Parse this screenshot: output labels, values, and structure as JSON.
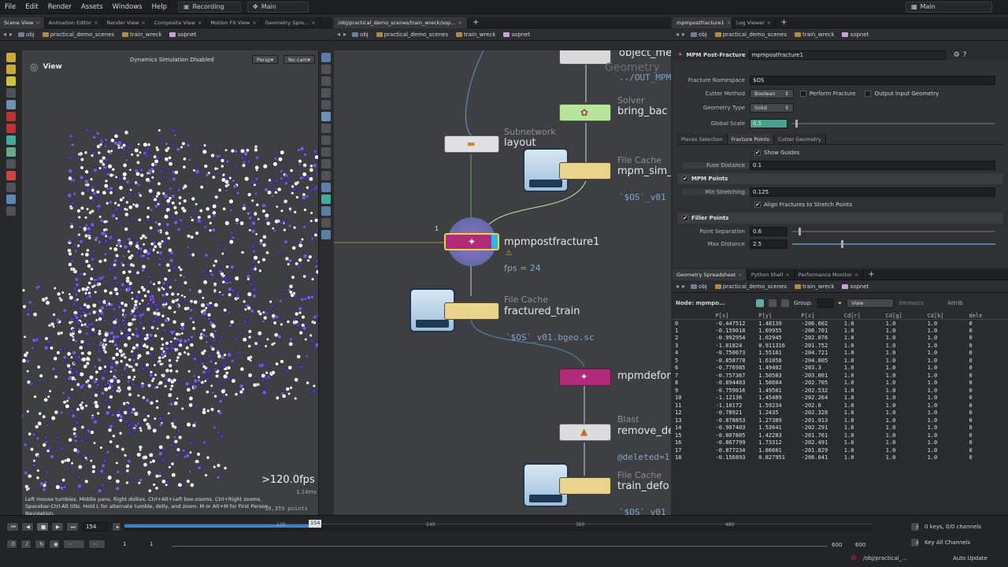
{
  "menubar": {
    "items": [
      "File",
      "Edit",
      "Render",
      "Assets",
      "Windows",
      "Help"
    ],
    "recording": "Recording",
    "desktop": "Main",
    "right_desktop": "Main"
  },
  "left_panel": {
    "tabs": [
      "Scene View",
      "Animation Editor",
      "Render View",
      "Composite View",
      "Motion FX View",
      "Geometry Spre..."
    ],
    "path": [
      "obj",
      "practical_demo_scenes",
      "train_wreck",
      "sopnet"
    ],
    "view_title": "View",
    "sim_status": "Dynamics Simulation Disabled",
    "camera": "Persp",
    "cam2": "No cam",
    "fps": ">120.0fps",
    "time_ms": "1.14ms",
    "points": "10,359  points",
    "hint": "Left mouse tumbles. Middle pans. Right dollies. Ctrl+Alt+Left box-zooms. Ctrl+Right zooms. Spacebar-Ctrl-Alt tilts. Hold L for alternate tumble, dolly, and zoom. M or Alt+M for First Person Navigation."
  },
  "network": {
    "tab": "/obj/practical_demo_scenes/train_wreck/sop...",
    "path": [
      "obj",
      "practical_demo_scenes",
      "train_wreck",
      "sopnet"
    ],
    "nodes": {
      "object_merge_label": "object_me",
      "object_merge_sub": "../OUT_MPM",
      "geometry_type": "Geometry",
      "solver_type": "Solver",
      "solver_label": "bring_bac",
      "subnet_type": "Subnetwork",
      "subnet_label": "layout",
      "filecache1_type": "File Cache",
      "filecache1_label": "mpm_sim_",
      "filecache1_sub": "`$OS`_v01",
      "post_label": "mpmpostfracture1",
      "post_fps": "fps = 24",
      "post_index": "1",
      "filecache2_type": "File Cache",
      "filecache2_label": "fractured_train",
      "filecache2_sub": "`$OS`_v01.bgeo.sc",
      "deform_label": "mpmdefor",
      "blast_type": "Blast",
      "blast_label": "remove_de",
      "blast_sub": "@deleted=1",
      "filecache3_type": "File Cache",
      "filecache3_label": "train_defo",
      "filecache3_sub": "`$OS`_v01"
    }
  },
  "params": {
    "tabs": [
      "mpmpostfracture1",
      "Log Viewer"
    ],
    "path": [
      "obj",
      "practical_demo_scenes",
      "train_wreck",
      "sopnet"
    ],
    "node_type": "MPM Post-Fracture",
    "node_name": "mpmpostfracture1",
    "namespace_label": "Fracture Namespace",
    "namespace_value": "$OS",
    "cutter_label": "Cutter Method",
    "cutter_value": "Boolean",
    "perform_fracture": "Perform Fracture",
    "output_input": "Output Input Geometry",
    "geotype_label": "Geometry Type",
    "geotype_value": "Solid",
    "scale_label": "Global Scale",
    "scale_value": "0.5",
    "subtabs": [
      "Pieces Selection",
      "Fracture Points",
      "Cutter Geometry"
    ],
    "show_guides": "Show Guides",
    "fuse_label": "Fuse Distance",
    "fuse_value": "0.1",
    "mpm_points": "MPM Points",
    "minstretch_label": "Min Stretching",
    "minstretch_value": "0.125",
    "align_label": "Align Fractures to Stretch Points",
    "filler_points": "Filler Points",
    "sep_label": "Point Separation",
    "sep_value": "0.6",
    "maxdist_label": "Max Distance",
    "maxdist_value": "2.5"
  },
  "spreadsheet": {
    "tabs": [
      "Geometry Spreadsheet",
      "Python Shell",
      "Performance Monitor"
    ],
    "path": [
      "obj",
      "practical_demo_scenes",
      "train_wreck",
      "sopnet"
    ],
    "node_label": "Node: mpmpo...",
    "group_label": "Group:",
    "view_label": "View",
    "intrinsics": "Intrinsics",
    "attrib": "Attrib",
    "columns": [
      "",
      "P[x]",
      "P[y]",
      "P[z]",
      "Cd[r]",
      "Cd[g]",
      "Cd[b]",
      "dele"
    ],
    "rows": [
      [
        "0",
        "-0.447512",
        "1.48139",
        "-206.602",
        "1.0",
        "1.0",
        "1.0",
        "0"
      ],
      [
        "1",
        "-0.159018",
        "1.69955",
        "-206.701",
        "1.0",
        "1.0",
        "1.0",
        "0"
      ],
      [
        "2",
        "-0.992954",
        "1.02945",
        "-202.076",
        "1.0",
        "1.0",
        "1.0",
        "0"
      ],
      [
        "3",
        "-1.01824",
        "0.911316",
        "-201.752",
        "1.0",
        "1.0",
        "1.0",
        "0"
      ],
      [
        "4",
        "-0.750673",
        "1.55161",
        "-204.721",
        "1.0",
        "1.0",
        "1.0",
        "0"
      ],
      [
        "5",
        "-0.858778",
        "1.61058",
        "-204.805",
        "1.0",
        "1.0",
        "1.0",
        "0"
      ],
      [
        "6",
        "-0.776985",
        "1.49402",
        "-203.3",
        "1.0",
        "1.0",
        "1.0",
        "0"
      ],
      [
        "7",
        "-0.757367",
        "1.50503",
        "-203.001",
        "1.0",
        "1.0",
        "1.0",
        "0"
      ],
      [
        "8",
        "-0.894403",
        "1.58684",
        "-202.705",
        "1.0",
        "1.0",
        "1.0",
        "0"
      ],
      [
        "9",
        "-0.759016",
        "1.49501",
        "-202.532",
        "1.0",
        "1.0",
        "1.0",
        "0"
      ],
      [
        "10",
        "-1.12136",
        "1.45489",
        "-202.264",
        "1.0",
        "1.0",
        "1.0",
        "0"
      ],
      [
        "11",
        "-1.10172",
        "1.59234",
        "-202.0",
        "1.0",
        "1.0",
        "1.0",
        "0"
      ],
      [
        "12",
        "-0.78921",
        "1.2435",
        "-202.328",
        "1.0",
        "1.0",
        "1.0",
        "0"
      ],
      [
        "13",
        "-0.878853",
        "1.27389",
        "-201.913",
        "1.0",
        "1.0",
        "1.0",
        "0"
      ],
      [
        "14",
        "-0.907403",
        "1.53641",
        "-202.291",
        "1.0",
        "1.0",
        "1.0",
        "0"
      ],
      [
        "15",
        "-0.807805",
        "1.42283",
        "-201.761",
        "1.0",
        "1.0",
        "1.0",
        "0"
      ],
      [
        "16",
        "-0.867799",
        "1.73312",
        "-202.491",
        "1.0",
        "1.0",
        "1.0",
        "0"
      ],
      [
        "17",
        "-0.877234",
        "1.86601",
        "-201.829",
        "1.0",
        "1.0",
        "1.0",
        "0"
      ],
      [
        "18",
        "-0.156893",
        "0.827951",
        "-206.041",
        "1.0",
        "1.0",
        "1.0",
        "0"
      ]
    ]
  },
  "timeline": {
    "frame": "154",
    "marker": "154",
    "ticks": [
      "1",
      "120",
      "240",
      "360",
      "480"
    ],
    "start": "1",
    "start2": "1",
    "end1": "600",
    "end2": "600",
    "keys": "0 keys, 0/0 channels",
    "key_all": "Key All Channels",
    "status_path": "/obj/practical_...",
    "auto_update": "Auto Update",
    "progress_fraction": 0.255
  }
}
